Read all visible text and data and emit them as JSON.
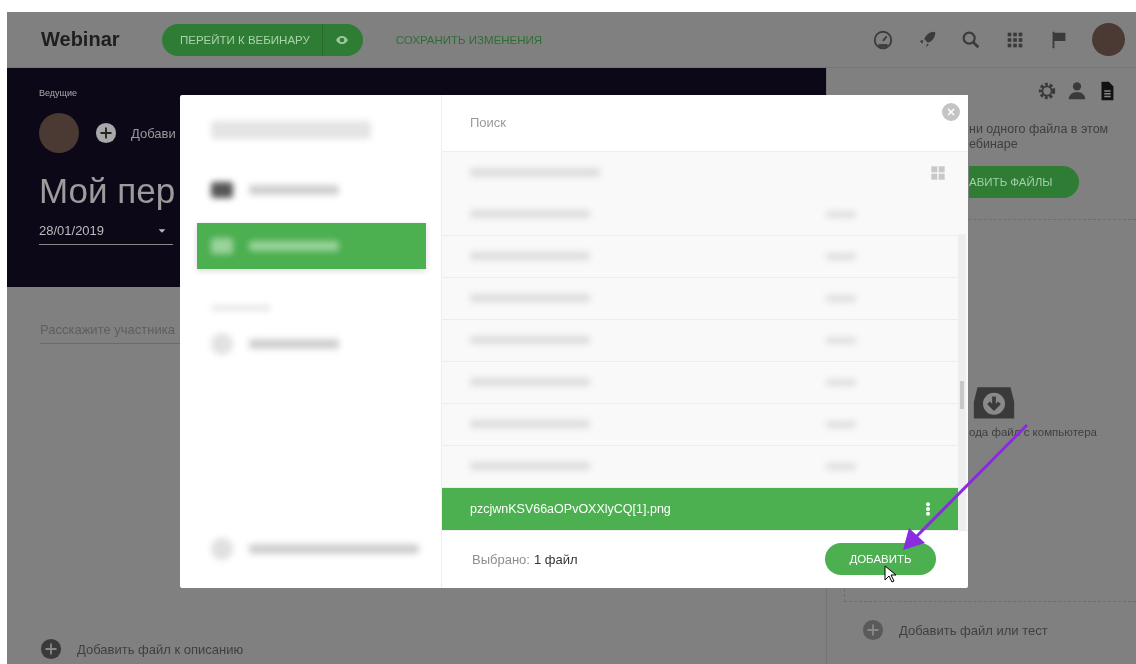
{
  "header": {
    "logo": "Webinar",
    "go_button": "ПЕРЕЙТИ К ВЕБИНАРУ",
    "save_link": "СОХРАНИТЬ ИЗМЕНЕНИЯ"
  },
  "hero": {
    "hosts_label": "Ведущие",
    "add_host": "Добави",
    "title": "Мой пер",
    "date": "28/01/2019"
  },
  "description": {
    "placeholder": "Расскажите участника",
    "add_file": "Добавить файл к описанию"
  },
  "side_panel": {
    "empty_text": [
      "ни одного файла в этом",
      "ебинаре"
    ],
    "add_button": "АВИТЬ ФАЙЛЫ",
    "upload_text": "ода файл с компьютера",
    "add_file_or_test": "Добавить файл или тест"
  },
  "modal": {
    "search": {
      "placeholder": "Поиск"
    },
    "sidebar_items": [
      {
        "kind": "item",
        "selected": false
      },
      {
        "kind": "item",
        "selected": true
      },
      {
        "kind": "section"
      },
      {
        "kind": "item",
        "selected": false
      }
    ],
    "file_rows": [
      {
        "selected": false
      },
      {
        "selected": false
      },
      {
        "selected": false
      },
      {
        "selected": false
      },
      {
        "selected": false
      },
      {
        "selected": false
      },
      {
        "selected": false
      },
      {
        "selected": true,
        "name": "pzcjwnKSV66aOPvOXXlyCQ[1].png"
      }
    ],
    "selected_label": "Выбрано:",
    "selected_count": "1 файл",
    "add_button": "ДОБАВИТЬ"
  }
}
